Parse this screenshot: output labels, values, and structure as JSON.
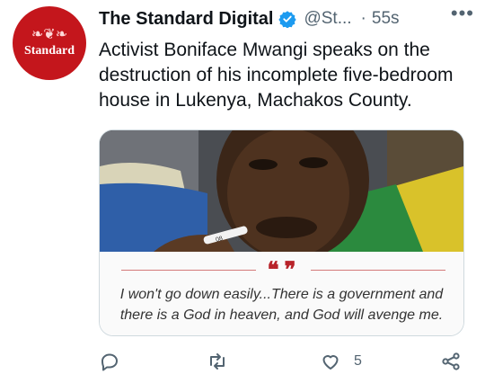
{
  "account": {
    "name": "The Standard Digital",
    "handle": "@St...",
    "separator": "·",
    "time": "55s",
    "avatar_text": "Standard",
    "avatar_crest": "❧❦❧"
  },
  "more_label": "•••",
  "tweet": {
    "text": "Activist Boniface Mwangi speaks on the destruction of his incomplete five-bedroom house in Lukenya, Machakos County."
  },
  "card": {
    "quote_marks": "❝ ❞",
    "quote_text": "I won't go down easily...There is a government and there is a God in heaven, and God will avenge me.",
    "pen_text": "08"
  },
  "actions": {
    "reply_count": "",
    "retweet_count": "",
    "like_count": "5"
  },
  "colors": {
    "brand_red": "#c4161c",
    "verified_blue": "#1d9bf0",
    "secondary_text": "#536471"
  },
  "icons": [
    "verified-badge-icon",
    "more-icon",
    "reply-icon",
    "retweet-icon",
    "like-icon",
    "share-icon"
  ]
}
